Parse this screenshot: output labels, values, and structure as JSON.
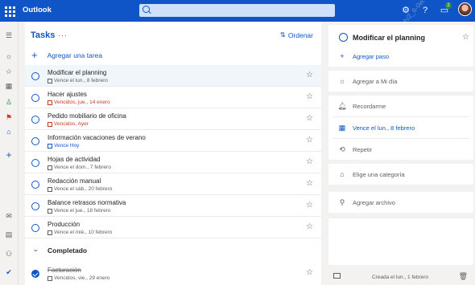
{
  "app": {
    "name": "Outlook"
  },
  "search": {
    "placeholder": ""
  },
  "topbar": {
    "notifications_count": "2"
  },
  "watermark": {
    "text": "bestv2_6-0w... ffa64"
  },
  "tasks_panel": {
    "title": "Tasks",
    "more_label": "···",
    "sort_label": "Ordenar",
    "add_task_label": "Agregar una tarea",
    "tasks": [
      {
        "title": "Modificar el planning",
        "due": "Vence el lun., 8 febrero",
        "status": "normal",
        "selected": true
      },
      {
        "title": "Hacer ajustes",
        "due": "Vencidos, jue., 14 enero",
        "status": "overdue",
        "selected": false
      },
      {
        "title": "Pedido mobiliario de oficina",
        "due": "Vencidos, Ayer",
        "status": "overdue",
        "selected": false
      },
      {
        "title": "Información vacaciones de verano",
        "due": "Vence Hoy",
        "status": "today",
        "selected": false
      },
      {
        "title": "Hojas de actividad",
        "due": "Vence el dom., 7 febrero",
        "status": "normal",
        "selected": false
      },
      {
        "title": "Redacción manual",
        "due": "Vence el sáb., 20 febrero",
        "status": "normal",
        "selected": false
      },
      {
        "title": "Balance retrasos normativa",
        "due": "Vence el jue., 18 febrero",
        "status": "normal",
        "selected": false
      },
      {
        "title": "Producción",
        "due": "Vence el mié., 10 febrero",
        "status": "normal",
        "selected": false
      }
    ],
    "completed_label": "Completado",
    "completed": [
      {
        "title": "Facturación",
        "due": "Vencidos, vie., 29 enero"
      }
    ]
  },
  "detail": {
    "task_title": "Modificar el planning",
    "add_step_label": "Agregar paso",
    "add_my_day_label": "Agregar a Mi día",
    "remind_label": "Recordarme",
    "due_label": "Vence el lun., 8 febrero",
    "repeat_label": "Repetir",
    "category_label": "Elige una categoría",
    "attach_label": "Agregar archivo",
    "footer_text": "Creada el lun., 1 febrero"
  },
  "colors": {
    "brand": "#0f55c8",
    "overdue": "#c13c26",
    "selected_row": "#eff6fc"
  }
}
